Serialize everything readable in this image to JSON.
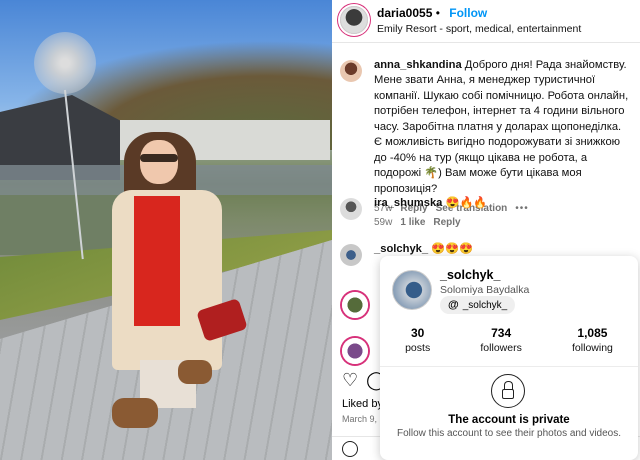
{
  "post": {
    "author": "daria0055",
    "follow_label": "Follow",
    "location": "Emily Resort - sport, medical, entertainment"
  },
  "comments": [
    {
      "user": "anna_shkandina",
      "text": "Доброго дня! Рада знайомству. Мене звати Анна, я менеджер туристичної компанії. Шукаю собі помічницю. Робота онлайн, потрібен телефон, інтернет та 4 години вільного часу. Заробітна платня у доларах щопонеділка. Є можливість вигідно подорожувати зі знижкою до -40% на тур (якщо цікава не робота, а подорожі 🌴) Вам може бути цікава моя пропозиція?",
      "age": "57w",
      "reply": "Reply",
      "see_translation": "See translation",
      "more": "•••"
    },
    {
      "user": "ira_shumska",
      "text": "😍🔥🔥",
      "age": "59w",
      "likes": "1 like",
      "reply": "Reply"
    },
    {
      "user": "_solchyk_",
      "text": "😍😍😍"
    }
  ],
  "footer": {
    "liked_prefix": "Liked by",
    "date": "March 9,"
  },
  "hover_card": {
    "username": "_solchyk_",
    "full_name": "Solomiya Baydalka",
    "threads_handle": "_solchyk_",
    "threads_icon": "@",
    "stats": [
      {
        "value": "30",
        "label": "posts"
      },
      {
        "value": "734",
        "label": "followers"
      },
      {
        "value": "1,085",
        "label": "following"
      }
    ],
    "private_title": "The account is private",
    "private_sub": "Follow this account to see their photos and videos."
  },
  "icons": {
    "heart": "♡",
    "comment": "◯"
  },
  "colors": {
    "follow": "#0095f6",
    "story_ring": "#d7317a"
  }
}
